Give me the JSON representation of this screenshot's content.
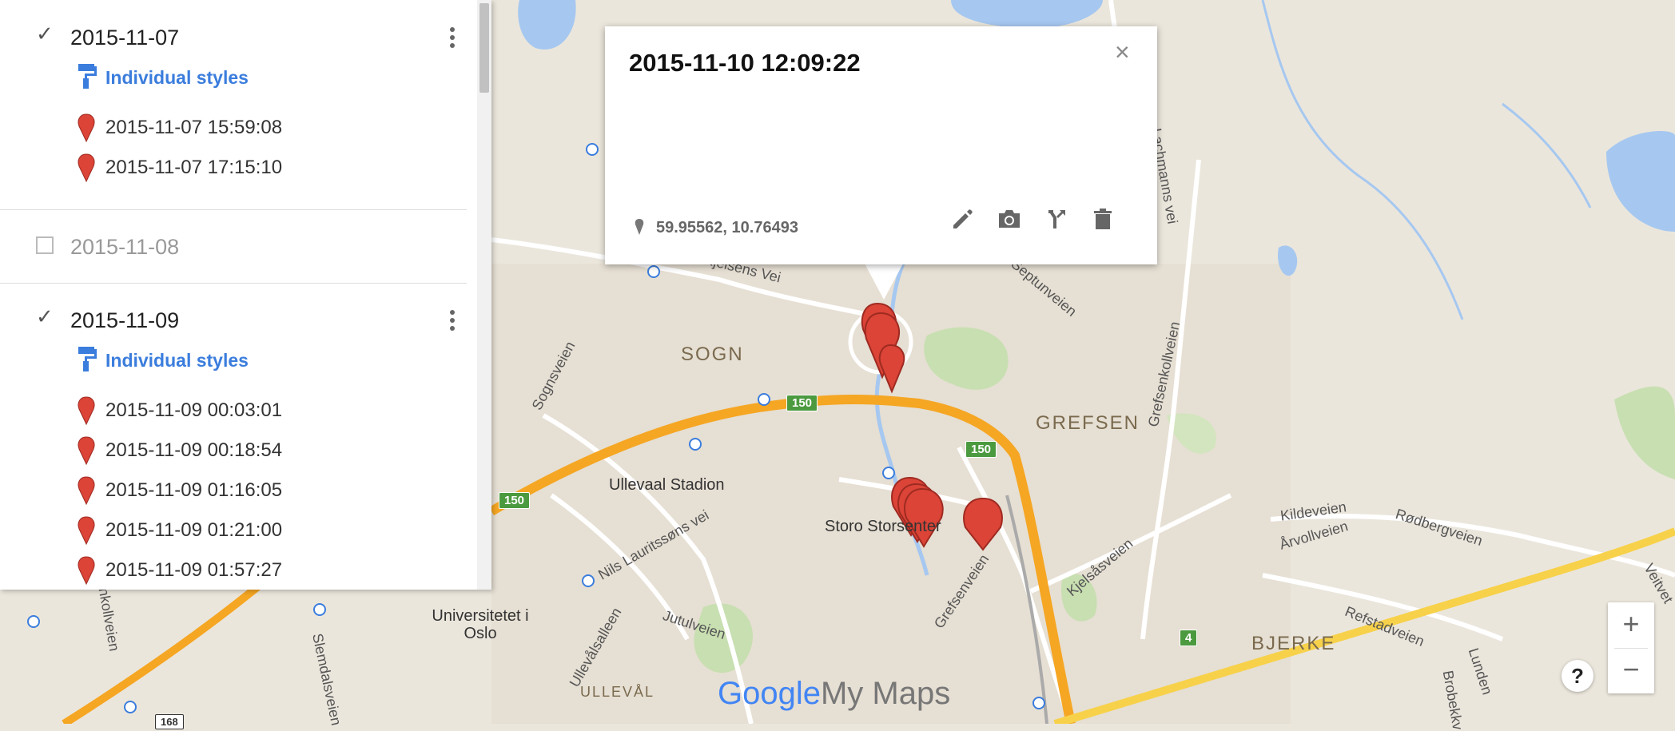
{
  "map": {
    "area_labels": [
      "SOGN",
      "GREFSEN",
      "BJERKE",
      "ULLEVÅL"
    ],
    "street_labels": [
      "Kjelsens Vei",
      "Sognsveien",
      "Nils Lauritssøns vei",
      "Ullevålsalleen",
      "Jutulveien",
      "Grefsenveien",
      "Kjelsåsveien",
      "Grefsenkollveien",
      "Kildeveien",
      "Årvollveien",
      "Rødbergveien",
      "Refstadveien",
      "Lunden",
      "Brobekkv",
      "Lachmanns vei",
      "Slemdalsveien",
      "enkollveien",
      "Veitvet",
      "Septunveien"
    ],
    "poi_labels": [
      "Ullevaal Stadion",
      "Storo Storsenter",
      "Universitetet i Oslo"
    ],
    "road_badges": [
      "150",
      "150",
      "150",
      "4",
      "168"
    ],
    "brand_google": "Google",
    "brand_mymaps": "My Maps"
  },
  "sidebar": {
    "layers": [
      {
        "title": "2015-11-07",
        "checked": true,
        "style_label": "Individual styles",
        "features": [
          "2015-11-07 15:59:08",
          "2015-11-07 17:15:10"
        ]
      },
      {
        "title": "2015-11-08",
        "checked": false
      },
      {
        "title": "2015-11-09",
        "checked": true,
        "style_label": "Individual styles",
        "features": [
          "2015-11-09 00:03:01",
          "2015-11-09 00:18:54",
          "2015-11-09 01:16:05",
          "2015-11-09 01:21:00",
          "2015-11-09 01:57:27"
        ]
      }
    ]
  },
  "popup": {
    "title": "2015-11-10 12:09:22",
    "coords": "59.95562, 10.76493",
    "close_glyph": "×",
    "actions": [
      "edit-icon",
      "camera-icon",
      "directions-icon",
      "delete-icon"
    ]
  },
  "controls": {
    "zoom_in": "+",
    "zoom_out": "−",
    "help": "?"
  },
  "colors": {
    "marker": "#db4437",
    "link": "#3b7ddd",
    "highway": "#f5a623",
    "map_bg": "#ebe6dc"
  }
}
